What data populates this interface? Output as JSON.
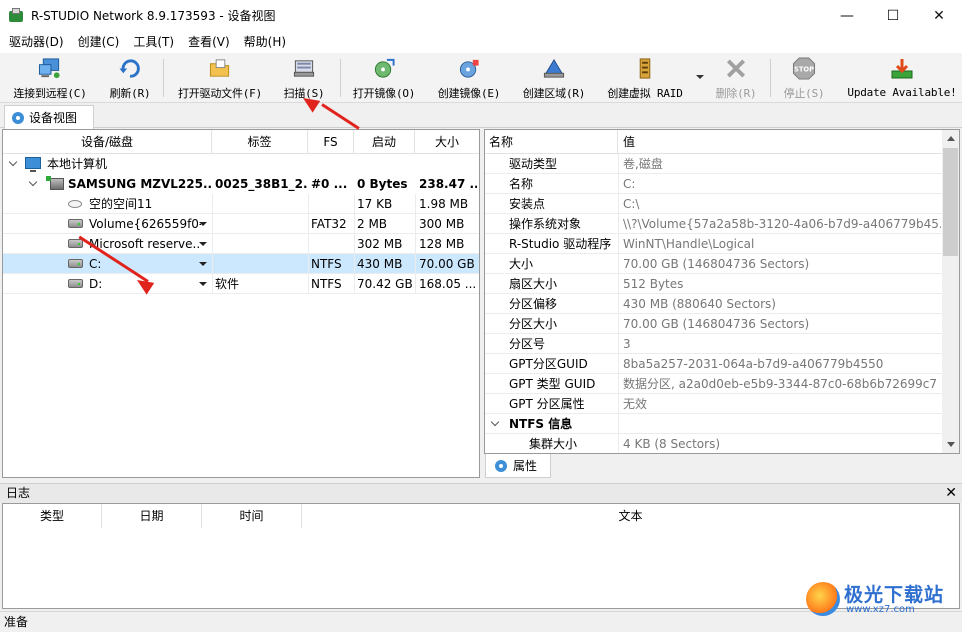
{
  "window": {
    "title": "R-STUDIO Network 8.9.173593 - 设备视图",
    "min_glyph": "—",
    "max_glyph": "☐",
    "close_glyph": "✕"
  },
  "menu": [
    "驱动器(D)",
    "创建(C)",
    "工具(T)",
    "查看(V)",
    "帮助(H)"
  ],
  "toolbar": {
    "connect": "连接到远程(C)",
    "refresh": "刷新(R)",
    "open_drive_file": "打开驱动文件(F)",
    "scan": "扫描(S)",
    "open_image": "打开镜像(O)",
    "create_image": "创建镜像(E)",
    "create_region": "创建区域(R)",
    "create_raid": "创建虚拟 RAID",
    "delete": "删除(R)",
    "stop": "停止(S)",
    "update": "Update Available!",
    "stop_icon_text": "STOP"
  },
  "doc_tab": "设备视图",
  "tree": {
    "headers": [
      "设备/磁盘",
      "标签",
      "FS",
      "启动",
      "大小"
    ],
    "root": "本地计算机",
    "disk": {
      "name": "SAMSUNG MZVL225...",
      "label": "0025_38B1_2...",
      "fs": "#0 ...",
      "start": "0 Bytes",
      "size": "238.47 ..."
    },
    "rows": [
      {
        "name": "空的空间11",
        "label": "",
        "fs": "",
        "start": "17 KB",
        "size": "1.98 MB",
        "icon": "free-space-icon",
        "dd": false
      },
      {
        "name": "Volume{626559f0-...",
        "label": "",
        "fs": "FAT32",
        "start": "2 MB",
        "size": "300 MB",
        "icon": "partition-icon",
        "dd": true
      },
      {
        "name": "Microsoft reserve...",
        "label": "",
        "fs": "",
        "start": "302 MB",
        "size": "128 MB",
        "icon": "partition-icon",
        "dd": true
      },
      {
        "name": "C:",
        "label": "",
        "fs": "NTFS",
        "start": "430 MB",
        "size": "70.00 GB",
        "icon": "partition-icon",
        "dd": true
      },
      {
        "name": "D:",
        "label": "软件",
        "fs": "NTFS",
        "start": "70.42 GB",
        "size": "168.05 ...",
        "icon": "partition-icon",
        "dd": true
      }
    ],
    "selected_index": 3
  },
  "properties": {
    "headers": [
      "名称",
      "值"
    ],
    "rows": [
      {
        "name": "驱动类型",
        "value": "卷,磁盘"
      },
      {
        "name": "名称",
        "value": "C:"
      },
      {
        "name": "安装点",
        "value": "C:\\"
      },
      {
        "name": "操作系统对象",
        "value": "\\\\?\\Volume{57a2a58b-3120-4a06-b7d9-a406779b45..."
      },
      {
        "name": "R-Studio 驱动程序",
        "value": "WinNT\\Handle\\Logical"
      },
      {
        "name": "大小",
        "value": "70.00 GB (146804736 Sectors)"
      },
      {
        "name": "扇区大小",
        "value": "512 Bytes"
      },
      {
        "name": "分区偏移",
        "value": "430 MB (880640 Sectors)"
      },
      {
        "name": "分区大小",
        "value": "70.00 GB (146804736 Sectors)"
      },
      {
        "name": "分区号",
        "value": "3"
      },
      {
        "name": "GPT分区GUID",
        "value": "8ba5a257-2031-064a-b7d9-a406779b4550"
      },
      {
        "name": "GPT 类型 GUID",
        "value": "数据分区, a2a0d0eb-e5b9-3344-87c0-68b6b72699c7"
      },
      {
        "name": "GPT 分区属性",
        "value": "无效"
      }
    ],
    "section": "NTFS 信息",
    "sub_rows": [
      {
        "name": "集群大小",
        "value": "4 KB (8 Sectors)"
      }
    ],
    "tab": "属性"
  },
  "log": {
    "title": "日志",
    "close_glyph": "✕",
    "headers": [
      "类型",
      "日期",
      "时间",
      "文本"
    ]
  },
  "status": "准备",
  "watermark": {
    "brand": "极光下载站",
    "url": "www.xz7.com"
  },
  "colors": {
    "selection": "#cce8ff",
    "annotation_arrow": "#e0241d"
  }
}
